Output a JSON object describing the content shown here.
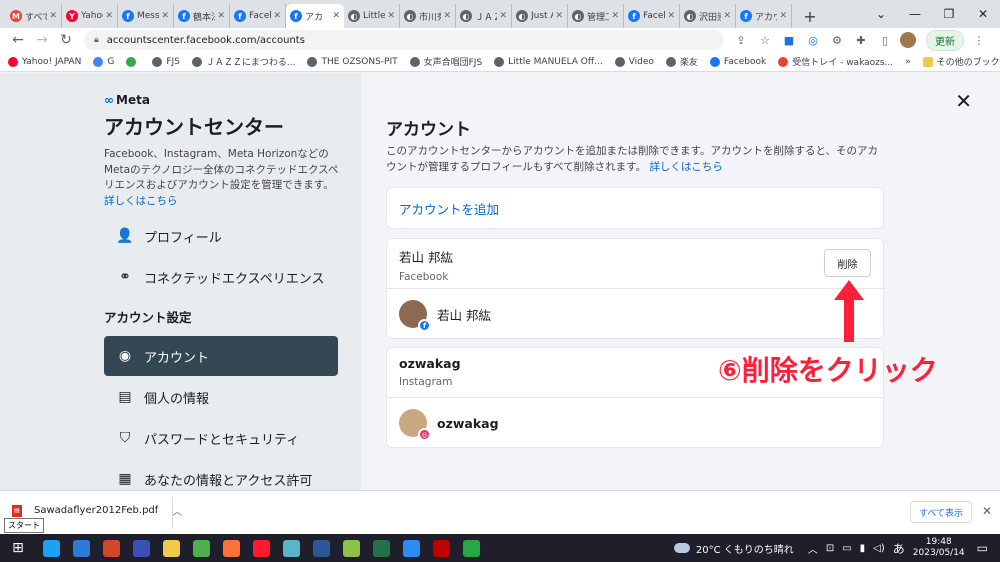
{
  "browser": {
    "tabs": [
      {
        "label": "すべての",
        "color": "#ea4335",
        "glyph": "M"
      },
      {
        "label": "Yahoo!",
        "color": "#ff0033",
        "glyph": "Y"
      },
      {
        "label": "Messe",
        "color": "#1877f2",
        "glyph": "f"
      },
      {
        "label": "鶴本法",
        "color": "#1877f2",
        "glyph": "f"
      },
      {
        "label": "Facebo",
        "color": "#1877f2",
        "glyph": "f"
      },
      {
        "label": "アカ",
        "color": "#1877f2",
        "glyph": "f",
        "active": true
      },
      {
        "label": "Little M",
        "color": "#5f6368",
        "glyph": "◐"
      },
      {
        "label": "市川秀",
        "color": "#5f6368",
        "glyph": "◐"
      },
      {
        "label": "ＪＡＺ",
        "color": "#5f6368",
        "glyph": "◐"
      },
      {
        "label": "Just A",
        "color": "#5f6368",
        "glyph": "◐"
      },
      {
        "label": "管理工",
        "color": "#5f6368",
        "glyph": "◐"
      },
      {
        "label": "Facebo",
        "color": "#1877f2",
        "glyph": "f"
      },
      {
        "label": "沢田崇",
        "color": "#5f6368",
        "glyph": "◐"
      },
      {
        "label": "アカウン",
        "color": "#1877f2",
        "glyph": "f"
      }
    ],
    "url": "accountscenter.facebook.com/accounts",
    "update_label": "更新",
    "bookmarks": [
      {
        "label": "Yahoo! JAPAN",
        "color": "#ff0033"
      },
      {
        "label": "G",
        "color": "#4285f4"
      },
      {
        "label": "",
        "color": "#34a853"
      },
      {
        "label": "FJS",
        "color": "#5f6368"
      },
      {
        "label": "ＪＡＺＺにまつわる...",
        "color": "#5f6368"
      },
      {
        "label": "THE OZSONS-PIT",
        "color": "#5f6368"
      },
      {
        "label": "女声合唱団FJS",
        "color": "#5f6368"
      },
      {
        "label": "Little MANUELA Off...",
        "color": "#5f6368"
      },
      {
        "label": "Video",
        "color": "#5f6368"
      },
      {
        "label": "楽友",
        "color": "#5f6368"
      },
      {
        "label": "Facebook",
        "color": "#1877f2"
      },
      {
        "label": "受信トレイ - wakaozs...",
        "color": "#ea4335"
      }
    ],
    "bookmarks_more": "»",
    "other_bookmarks": "その他のブックマーク"
  },
  "sidebar": {
    "logo": "Meta",
    "title": "アカウントセンター",
    "description": "Facebook、Instagram、Meta Horizonなどの Metaのテクノロジー全体のコネクテッドエクスペリエンスおよびアカウント設定を管理できます。",
    "learn_more": "詳しくはこちら",
    "items": [
      {
        "label": "プロフィール",
        "icon": "👤"
      },
      {
        "label": "コネクテッドエクスペリエンス",
        "icon": "⚭"
      }
    ],
    "section_label": "アカウント設定",
    "settings": [
      {
        "label": "アカウント",
        "icon": "◉"
      },
      {
        "label": "個人の情報",
        "icon": "▤"
      },
      {
        "label": "パスワードとセキュリティ",
        "icon": "⛉"
      },
      {
        "label": "あなたの情報とアクセス許可",
        "icon": "▦"
      }
    ]
  },
  "main": {
    "title": "アカウント",
    "description": "このアカウントセンターからアカウントを追加または削除できます。アカウントを削除すると、そのアカウントが管理するプロフィールもすべて削除されます。",
    "learn_more": "詳しくはこちら",
    "add_account": "アカウントを追加",
    "accounts": [
      {
        "name": "若山 邦紘",
        "platform": "Facebook",
        "profile_name": "若山 邦紘",
        "delete_label": "削除",
        "badge_color": "#1877f2",
        "badge_glyph": "f"
      },
      {
        "name": "ozwakag",
        "platform": "Instagram",
        "profile_name": "ozwakag",
        "badge_color": "#e1306c",
        "badge_glyph": "◎"
      }
    ]
  },
  "annotation": "⑥削除をクリック",
  "downloads": {
    "file": "Sawadaflyer2012Feb.pdf",
    "show_all": "すべて表示"
  },
  "tooltip": "スタート",
  "taskbar": {
    "apps": [
      {
        "name": "edge",
        "color": "#1da1f2"
      },
      {
        "name": "ie",
        "color": "#2b7bd6"
      },
      {
        "name": "powerpoint",
        "color": "#d24726"
      },
      {
        "name": "app-circle",
        "color": "#3b4fb8"
      },
      {
        "name": "file-explorer",
        "color": "#f2c94c"
      },
      {
        "name": "chrome",
        "color": "#4caf50"
      },
      {
        "name": "firefox",
        "color": "#ff7139"
      },
      {
        "name": "opera",
        "color": "#ff1b2d"
      },
      {
        "name": "notebook",
        "color": "#5bb5c8"
      },
      {
        "name": "word",
        "color": "#2b579a"
      },
      {
        "name": "notepad",
        "color": "#8bc34a"
      },
      {
        "name": "excel",
        "color": "#217346"
      },
      {
        "name": "photos",
        "color": "#2d8cf0"
      },
      {
        "name": "filezilla",
        "color": "#bf0000"
      },
      {
        "name": "app-green",
        "color": "#28a745"
      }
    ],
    "weather": "20°C くもりのち晴れ",
    "ime": "あ",
    "time": "19:48",
    "date": "2023/05/14"
  }
}
